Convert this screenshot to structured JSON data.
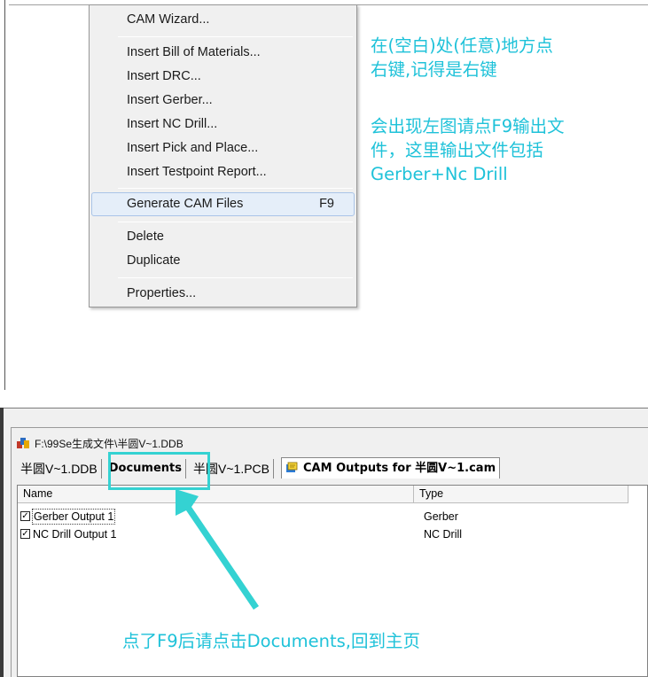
{
  "context_menu": {
    "items": [
      {
        "label": "CAM Wizard..."
      },
      {
        "label": "Insert Bill of Materials..."
      },
      {
        "label": "Insert DRC..."
      },
      {
        "label": "Insert Gerber..."
      },
      {
        "label": "Insert NC Drill..."
      },
      {
        "label": "Insert Pick and Place..."
      },
      {
        "label": "Insert Testpoint Report..."
      },
      {
        "label": "Generate CAM Files",
        "shortcut": "F9"
      },
      {
        "label": "Delete"
      },
      {
        "label": "Duplicate"
      },
      {
        "label": "Properties..."
      }
    ]
  },
  "annotations": {
    "note1_line1": "在(空白)处(任意)地方点",
    "note1_line2": "右键,记得是右键",
    "note2_line1": "会出现左图请点F9输出文",
    "note2_line2": "件，这里输出文件包括",
    "note2_line3": "Gerber+Nc Drill",
    "note3": "点了F9后请点击Documents,回到主页",
    "accent_color": "#1fc2d9"
  },
  "document_window": {
    "title": "F:\\99Se生成文件\\半圆V~1.DDB",
    "tabs": [
      {
        "label": "半圆V~1.DDB"
      },
      {
        "label": "Documents"
      },
      {
        "label": "半圆V~1.PCB"
      },
      {
        "label": "CAM Outputs for 半圆V~1.cam"
      }
    ],
    "columns": {
      "name": "Name",
      "type": "Type"
    },
    "rows": [
      {
        "checked": "✓",
        "name": "Gerber Output 1",
        "type": "Gerber"
      },
      {
        "checked": "✓",
        "name": "NC Drill Output 1",
        "type": "NC Drill"
      }
    ]
  }
}
